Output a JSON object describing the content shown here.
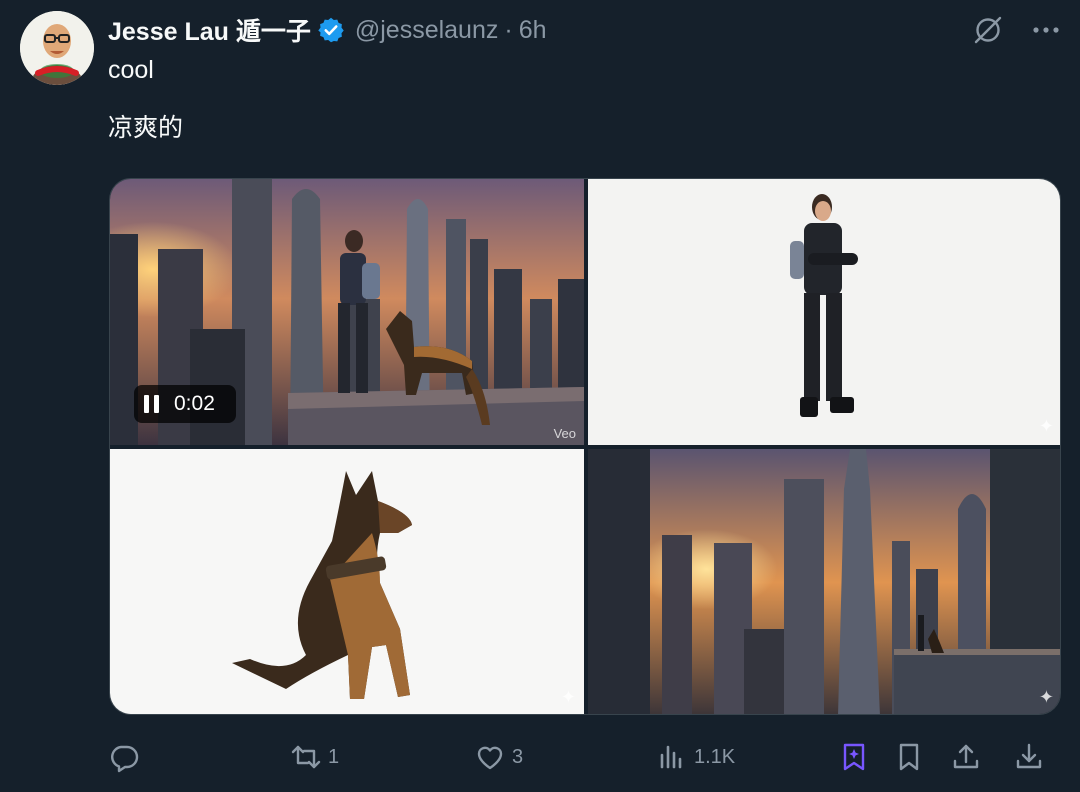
{
  "author": {
    "display_name": "Jesse Lau 遁一子",
    "handle": "@jesselaunz",
    "separator": "·",
    "time": "6h",
    "avatar_caption": "jesse lau"
  },
  "tweet": {
    "line1": "cool",
    "line2": "凉爽的"
  },
  "media": {
    "video_time": "0:02",
    "watermark": "Veo",
    "sparkle": "✦"
  },
  "actions": {
    "replies": "",
    "reposts": "1",
    "likes": "3",
    "views": "1.1K"
  },
  "colors": {
    "background": "#15202b",
    "secondary_text": "#8b98a5",
    "verified": "#1d9bf0",
    "grok_accent": "#7856ff"
  },
  "icons": [
    "avatar",
    "verified-badge-icon",
    "grok-icon",
    "more-icon",
    "reply-icon",
    "repost-icon",
    "like-icon",
    "views-icon",
    "grok-actions-icon",
    "bookmark-icon",
    "share-icon",
    "download-icon",
    "pause-icon"
  ]
}
